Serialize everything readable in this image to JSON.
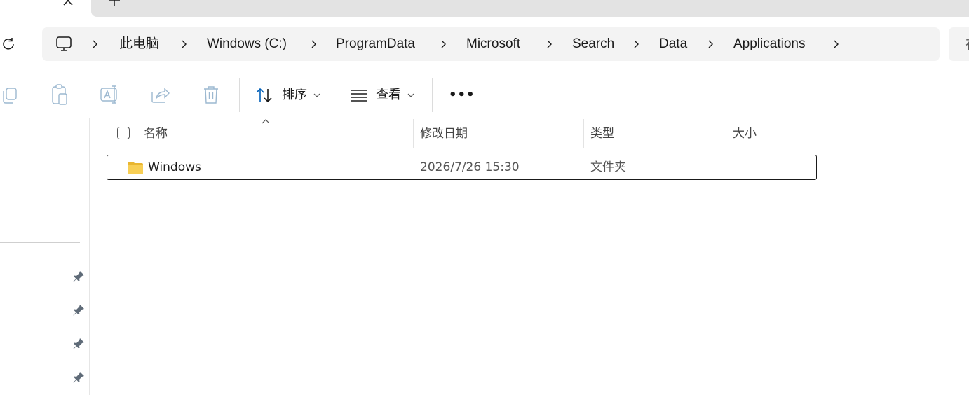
{
  "tabbar": {
    "close_icon": "close-icon",
    "new_tab_icon": "plus-icon"
  },
  "address": {
    "refresh_icon": "refresh-icon",
    "computer_icon": "computer-icon",
    "breadcrumb": [
      "此电脑",
      "Windows (C:)",
      "ProgramData",
      "Microsoft",
      "Search",
      "Data",
      "Applications"
    ],
    "search_hint": "在"
  },
  "toolbar": {
    "icons": [
      "copy-icon",
      "paste-icon",
      "rename-icon",
      "share-icon",
      "delete-icon"
    ],
    "sort_label": "排序",
    "view_label": "查看",
    "more_label": "•••"
  },
  "nav": {
    "pinned_count": 4
  },
  "columns": {
    "name": "名称",
    "modified": "修改日期",
    "type": "类型",
    "size": "大小"
  },
  "files": [
    {
      "name": "Windows",
      "modified": "2026/7/26 15:30",
      "type": "文件夹",
      "size": ""
    }
  ],
  "colors": {
    "folder": "#f5c542",
    "address_bg": "#f3f3f3",
    "tab_bg": "#e3e3e3",
    "accent": "#005fb8"
  }
}
